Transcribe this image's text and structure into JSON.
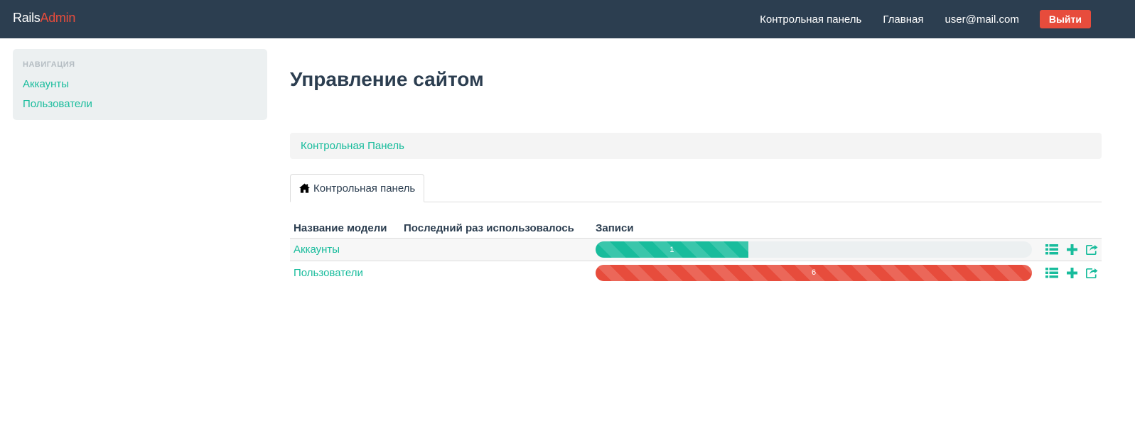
{
  "navbar": {
    "brand_main": "Rails",
    "brand_accent": "Admin",
    "links": [
      "Контрольная панель",
      "Главная",
      "user@mail.com"
    ],
    "logout_label": "Выйти"
  },
  "sidebar": {
    "heading": "Навигация",
    "items": [
      {
        "label": "Аккаунты"
      },
      {
        "label": "Пользователи"
      }
    ]
  },
  "main": {
    "title": "Управление сайтом",
    "breadcrumb": "Контрольная Панель",
    "tab": {
      "label": "Контрольная панель",
      "icon": "home-icon"
    },
    "table": {
      "headers": [
        "Название модели",
        "Последний раз использовалось",
        "Записи"
      ],
      "rows": [
        {
          "name": "Аккаунты",
          "last_used": "",
          "count": "1",
          "fill_fraction": 0.35,
          "color": "#18bc9c"
        },
        {
          "name": "Пользователи",
          "last_used": "",
          "count": "6",
          "fill_fraction": 1.0,
          "color": "#e74c3c"
        }
      ],
      "row_actions": [
        "list-icon",
        "plus-icon",
        "export-icon"
      ]
    }
  },
  "colors": {
    "navbar_bg": "#2c3e50",
    "accent_green": "#18bc9c",
    "accent_red": "#e74c3c",
    "sidebar_bg": "#ecf0f1"
  }
}
